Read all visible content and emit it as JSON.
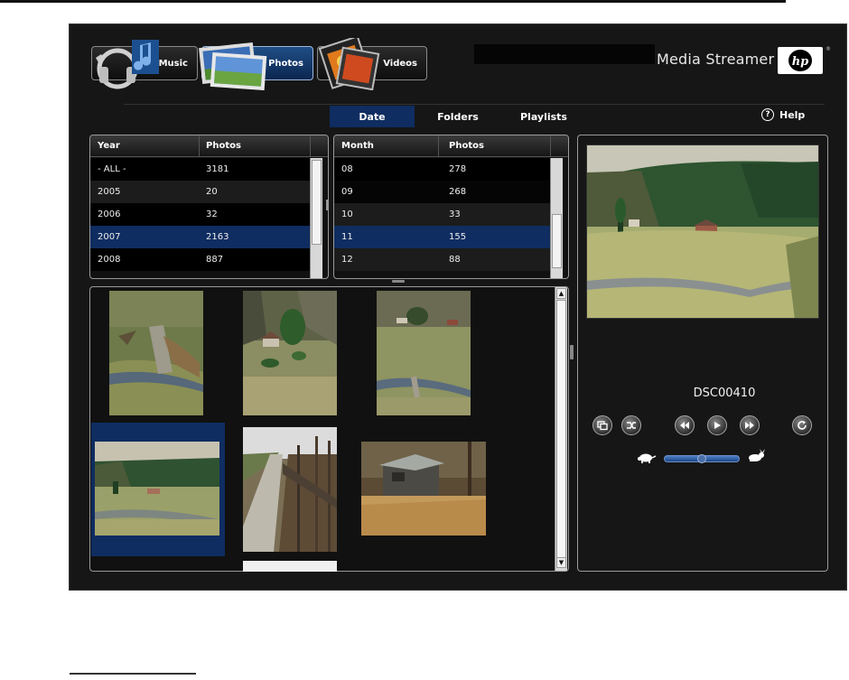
{
  "header": {
    "nav": [
      {
        "label": "Music",
        "icon": "music-icon"
      },
      {
        "label": "Photos",
        "icon": "photos-icon",
        "active": true
      },
      {
        "label": "Videos",
        "icon": "videos-icon"
      }
    ],
    "brand": "Media Streamer",
    "logo_text": "hp",
    "registered": "®"
  },
  "tabs": [
    {
      "label": "Date",
      "active": true
    },
    {
      "label": "Folders"
    },
    {
      "label": "Playlists"
    }
  ],
  "help": {
    "label": "Help",
    "icon_glyph": "?"
  },
  "year_table": {
    "headers": [
      "Year",
      "Photos"
    ],
    "rows": [
      [
        "- ALL -",
        "3181"
      ],
      [
        "2005",
        "20"
      ],
      [
        "2006",
        "32"
      ],
      [
        "2007",
        "2163"
      ],
      [
        "2008",
        "887"
      ]
    ],
    "selected_index": 3
  },
  "month_table": {
    "headers": [
      "Month",
      "Photos"
    ],
    "rows": [
      [
        "08",
        "278"
      ],
      [
        "09",
        "268"
      ],
      [
        "10",
        "33"
      ],
      [
        "11",
        "155"
      ],
      [
        "12",
        "88"
      ]
    ],
    "selected_index": 3
  },
  "thumbnails": {
    "selected_index": 3
  },
  "preview": {
    "filename": "DSC00410",
    "controls": [
      "slideshow-icon",
      "shuffle-icon",
      "rewind-icon",
      "play-icon",
      "fast-forward-icon",
      "rotate-icon"
    ],
    "speed_slow_icon": "turtle-icon",
    "speed_fast_icon": "rabbit-icon",
    "speed_level": 0.5
  },
  "colors": {
    "background": "#161616",
    "selection": "#0f2d60",
    "accent": "#1f4e86"
  }
}
